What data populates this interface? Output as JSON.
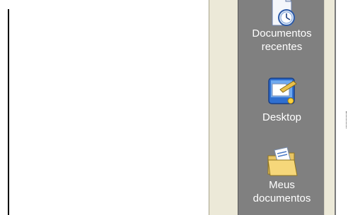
{
  "places_bar": {
    "items": [
      {
        "label": "Documentos\nrecentes",
        "icon": "recent-documents-icon"
      },
      {
        "label": "Desktop",
        "icon": "desktop-icon"
      },
      {
        "label": "Meus\ndocumentos",
        "icon": "my-documents-icon"
      }
    ]
  },
  "colors": {
    "places_bar_bg": "#808080",
    "frame_bg": "#ece9d8",
    "label_text": "#ffffff"
  }
}
